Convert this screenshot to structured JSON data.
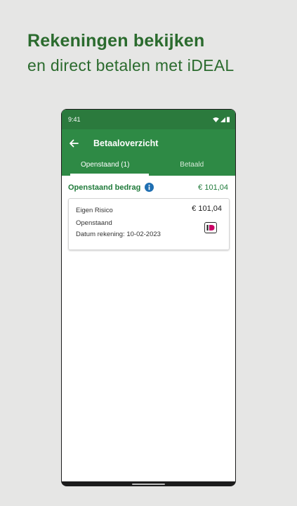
{
  "headline": {
    "line1": "Rekeningen bekijken",
    "line2": "en direct betalen met iDEAL"
  },
  "status_bar": {
    "time": "9:41"
  },
  "app_bar": {
    "title": "Betaaloverzicht"
  },
  "tabs": [
    {
      "label": "Openstaand (1)",
      "active": true
    },
    {
      "label": "Betaald",
      "active": false
    }
  ],
  "summary": {
    "label": "Openstaand bedrag",
    "amount": "€ 101,04"
  },
  "invoices": [
    {
      "name": "Eigen Risico",
      "amount": "€ 101,04",
      "status": "Openstaand",
      "date": "Datum rekening: 10-02-2023",
      "payment_icon": "ideal-icon"
    }
  ],
  "colors": {
    "brand_green": "#2e8a45",
    "status_green": "#2b7a3d",
    "headline_green": "#2b6b2e",
    "info_blue": "#1f6fb2",
    "ideal_pink": "#cc0066",
    "background": "#e6e6e5"
  }
}
